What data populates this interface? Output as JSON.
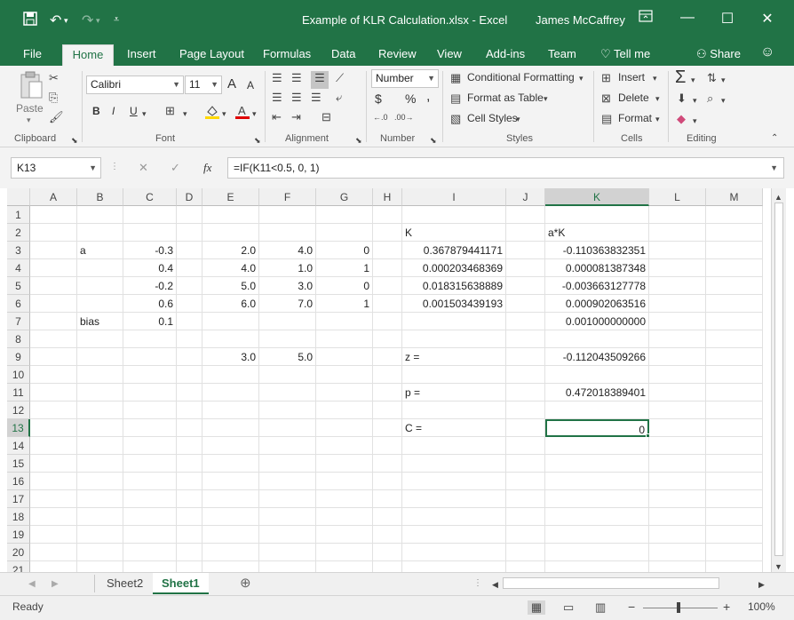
{
  "window": {
    "title": "Example of KLR Calculation.xlsx  -  Excel",
    "user": "James McCaffrey",
    "accent_color": "#217346"
  },
  "ribbon_tabs": [
    "File",
    "Home",
    "Insert",
    "Page Layout",
    "Formulas",
    "Data",
    "Review",
    "View",
    "Add-ins",
    "Team",
    "Tell me"
  ],
  "share_label": "Share",
  "ribbon": {
    "clipboard": {
      "paste": "Paste",
      "label": "Clipboard"
    },
    "font": {
      "name": "Calibri",
      "size": "11",
      "bold": "B",
      "italic": "I",
      "underline": "U",
      "grow": "A",
      "shrink": "A",
      "label": "Font"
    },
    "alignment": {
      "label": "Alignment"
    },
    "number": {
      "format": "Number",
      "currency": "$",
      "percent": "%",
      "comma": ",",
      "label": "Number"
    },
    "styles": {
      "conditional": "Conditional Formatting",
      "format_table": "Format as Table",
      "cell_styles": "Cell Styles",
      "label": "Styles"
    },
    "cells": {
      "insert": "Insert",
      "delete": "Delete",
      "format": "Format",
      "label": "Cells"
    },
    "editing": {
      "sum": "Σ",
      "label": "Editing"
    }
  },
  "formula_bar": {
    "name_box": "K13",
    "fx": "fx",
    "formula": "=IF(K11<0.5, 0, 1)"
  },
  "grid": {
    "columns": [
      "A",
      "B",
      "C",
      "D",
      "E",
      "F",
      "G",
      "H",
      "I",
      "J",
      "K",
      "L",
      "M"
    ],
    "rows": [
      "1",
      "2",
      "3",
      "4",
      "5",
      "6",
      "7",
      "8",
      "9",
      "10",
      "11",
      "12",
      "13",
      "14",
      "15",
      "16",
      "17",
      "18",
      "19",
      "20",
      "21"
    ],
    "selected_col": "K",
    "selected_row": "13",
    "cells": {
      "I2": "K",
      "K2": "a*K",
      "B3": "a",
      "C3": "-0.3",
      "E3": "2.0",
      "F3": "4.0",
      "G3": "0",
      "I3": "0.367879441171",
      "K3": "-0.110363832351",
      "C4": "0.4",
      "E4": "4.0",
      "F4": "1.0",
      "G4": "1",
      "I4": "0.000203468369",
      "K4": "0.000081387348",
      "C5": "-0.2",
      "E5": "5.0",
      "F5": "3.0",
      "G5": "0",
      "I5": "0.018315638889",
      "K5": "-0.003663127778",
      "C6": "0.6",
      "E6": "6.0",
      "F6": "7.0",
      "G6": "1",
      "I6": "0.001503439193",
      "K6": "0.000902063516",
      "B7": "bias",
      "C7": "0.1",
      "K7": "0.001000000000",
      "E9": "3.0",
      "F9": "5.0",
      "I9": "z =",
      "K9": "-0.112043509266",
      "I11": "p =",
      "K11": "0.472018389401",
      "I13": "C =",
      "K13": "0"
    }
  },
  "sheets": [
    "Sheet2",
    "Sheet1"
  ],
  "active_sheet": "Sheet1",
  "status": {
    "ready": "Ready",
    "zoom": "100%"
  }
}
